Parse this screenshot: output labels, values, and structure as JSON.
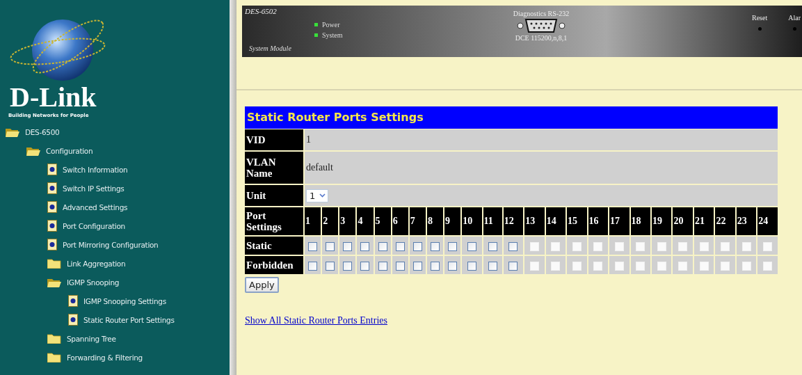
{
  "sidebar": {
    "logo": {
      "brand": "D-Link",
      "tagline": "Building Networks for People"
    },
    "tree": [
      {
        "label": "DES-6500",
        "kind": "folder",
        "expanded": true,
        "children": [
          {
            "label": "Configuration",
            "kind": "folder",
            "expanded": true,
            "children": [
              {
                "label": "Switch Information",
                "kind": "page"
              },
              {
                "label": "Switch IP Settings",
                "kind": "page"
              },
              {
                "label": "Advanced Settings",
                "kind": "page"
              },
              {
                "label": "Port Configuration",
                "kind": "page"
              },
              {
                "label": "Port Mirroring Configuration",
                "kind": "page"
              },
              {
                "label": "Link Aggregation",
                "kind": "folder",
                "expanded": false
              },
              {
                "label": "IGMP Snooping",
                "kind": "folder",
                "expanded": true,
                "children": [
                  {
                    "label": "IGMP Snooping Settings",
                    "kind": "page"
                  },
                  {
                    "label": "Static Router Port Settings",
                    "kind": "page"
                  }
                ]
              },
              {
                "label": "Spanning Tree",
                "kind": "folder",
                "expanded": false
              },
              {
                "label": "Forwarding & Filtering",
                "kind": "folder",
                "expanded": false
              }
            ]
          }
        ]
      }
    ]
  },
  "device": {
    "model": "DES-6502",
    "leds": [
      {
        "label": "Power",
        "on": true
      },
      {
        "label": "System",
        "on": true
      }
    ],
    "module": "System Module",
    "port_title": "Diagnostics RS-232",
    "port_settings": "DCE 115200,n,8,1",
    "buttons": [
      "Reset",
      "Alar"
    ]
  },
  "form": {
    "title": "Static Router Ports Settings",
    "vid": {
      "label": "VID",
      "value": "1"
    },
    "vlan_name": {
      "label": "VLAN Name",
      "value": "default"
    },
    "unit": {
      "label": "Unit",
      "value": "1"
    },
    "ports_label": "Port Settings",
    "static_label": "Static",
    "forbidden_label": "Forbidden",
    "ports": [
      {
        "number": "1",
        "static": false,
        "forbidden": false,
        "disabled": false
      },
      {
        "number": "2",
        "static": false,
        "forbidden": false,
        "disabled": false
      },
      {
        "number": "3",
        "static": false,
        "forbidden": false,
        "disabled": false
      },
      {
        "number": "4",
        "static": false,
        "forbidden": false,
        "disabled": false
      },
      {
        "number": "5",
        "static": false,
        "forbidden": false,
        "disabled": false
      },
      {
        "number": "6",
        "static": false,
        "forbidden": false,
        "disabled": false
      },
      {
        "number": "7",
        "static": false,
        "forbidden": false,
        "disabled": false
      },
      {
        "number": "8",
        "static": false,
        "forbidden": false,
        "disabled": false
      },
      {
        "number": "9",
        "static": false,
        "forbidden": false,
        "disabled": false
      },
      {
        "number": "10",
        "static": false,
        "forbidden": false,
        "disabled": false
      },
      {
        "number": "11",
        "static": false,
        "forbidden": false,
        "disabled": false
      },
      {
        "number": "12",
        "static": false,
        "forbidden": false,
        "disabled": false
      },
      {
        "number": "13",
        "static": false,
        "forbidden": false,
        "disabled": true
      },
      {
        "number": "14",
        "static": false,
        "forbidden": false,
        "disabled": true
      },
      {
        "number": "15",
        "static": false,
        "forbidden": false,
        "disabled": true
      },
      {
        "number": "16",
        "static": false,
        "forbidden": false,
        "disabled": true
      },
      {
        "number": "17",
        "static": false,
        "forbidden": false,
        "disabled": true
      },
      {
        "number": "18",
        "static": false,
        "forbidden": false,
        "disabled": true
      },
      {
        "number": "19",
        "static": false,
        "forbidden": false,
        "disabled": true
      },
      {
        "number": "20",
        "static": false,
        "forbidden": false,
        "disabled": true
      },
      {
        "number": "21",
        "static": false,
        "forbidden": false,
        "disabled": true
      },
      {
        "number": "22",
        "static": false,
        "forbidden": false,
        "disabled": true
      },
      {
        "number": "23",
        "static": false,
        "forbidden": false,
        "disabled": true
      },
      {
        "number": "24",
        "static": false,
        "forbidden": false,
        "disabled": true
      }
    ],
    "apply": "Apply",
    "link": "Show All Static Router Ports Entries"
  }
}
